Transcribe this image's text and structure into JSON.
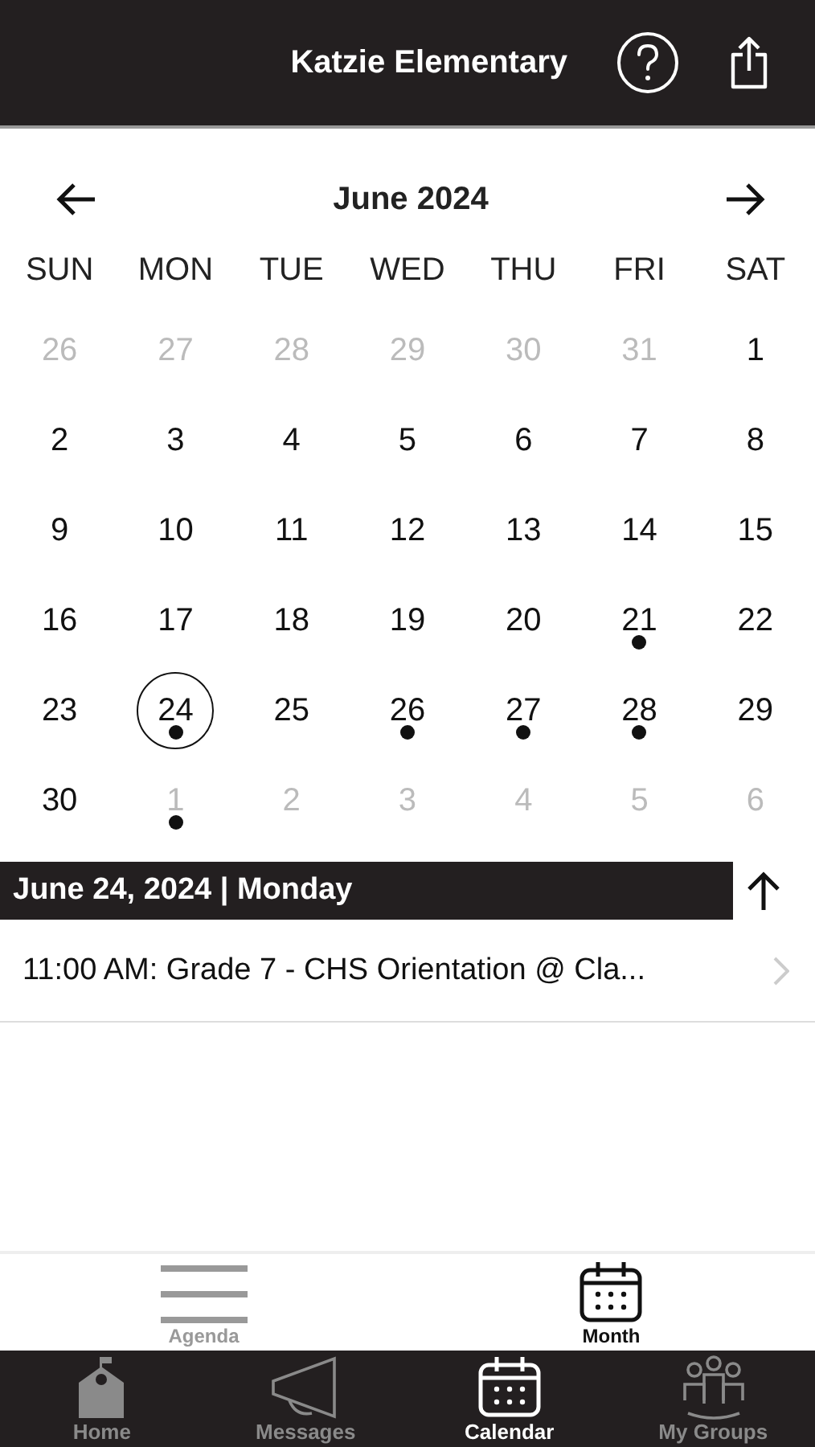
{
  "header": {
    "title": "Katzie Elementary"
  },
  "calendar": {
    "month": "June 2024",
    "weekdays": [
      "SUN",
      "MON",
      "TUE",
      "WED",
      "THU",
      "FRI",
      "SAT"
    ],
    "weeks": [
      [
        {
          "day": "26",
          "outside": true,
          "selected": false,
          "has_event": false
        },
        {
          "day": "27",
          "outside": true,
          "selected": false,
          "has_event": false
        },
        {
          "day": "28",
          "outside": true,
          "selected": false,
          "has_event": false
        },
        {
          "day": "29",
          "outside": true,
          "selected": false,
          "has_event": false
        },
        {
          "day": "30",
          "outside": true,
          "selected": false,
          "has_event": false
        },
        {
          "day": "31",
          "outside": true,
          "selected": false,
          "has_event": false
        },
        {
          "day": "1",
          "outside": false,
          "selected": false,
          "has_event": false
        }
      ],
      [
        {
          "day": "2",
          "outside": false,
          "selected": false,
          "has_event": false
        },
        {
          "day": "3",
          "outside": false,
          "selected": false,
          "has_event": false
        },
        {
          "day": "4",
          "outside": false,
          "selected": false,
          "has_event": false
        },
        {
          "day": "5",
          "outside": false,
          "selected": false,
          "has_event": false
        },
        {
          "day": "6",
          "outside": false,
          "selected": false,
          "has_event": false
        },
        {
          "day": "7",
          "outside": false,
          "selected": false,
          "has_event": false
        },
        {
          "day": "8",
          "outside": false,
          "selected": false,
          "has_event": false
        }
      ],
      [
        {
          "day": "9",
          "outside": false,
          "selected": false,
          "has_event": false
        },
        {
          "day": "10",
          "outside": false,
          "selected": false,
          "has_event": false
        },
        {
          "day": "11",
          "outside": false,
          "selected": false,
          "has_event": false
        },
        {
          "day": "12",
          "outside": false,
          "selected": false,
          "has_event": false
        },
        {
          "day": "13",
          "outside": false,
          "selected": false,
          "has_event": false
        },
        {
          "day": "14",
          "outside": false,
          "selected": false,
          "has_event": false
        },
        {
          "day": "15",
          "outside": false,
          "selected": false,
          "has_event": false
        }
      ],
      [
        {
          "day": "16",
          "outside": false,
          "selected": false,
          "has_event": false
        },
        {
          "day": "17",
          "outside": false,
          "selected": false,
          "has_event": false
        },
        {
          "day": "18",
          "outside": false,
          "selected": false,
          "has_event": false
        },
        {
          "day": "19",
          "outside": false,
          "selected": false,
          "has_event": false
        },
        {
          "day": "20",
          "outside": false,
          "selected": false,
          "has_event": false
        },
        {
          "day": "21",
          "outside": false,
          "selected": false,
          "has_event": true
        },
        {
          "day": "22",
          "outside": false,
          "selected": false,
          "has_event": false
        }
      ],
      [
        {
          "day": "23",
          "outside": false,
          "selected": false,
          "has_event": false
        },
        {
          "day": "24",
          "outside": false,
          "selected": true,
          "has_event": true
        },
        {
          "day": "25",
          "outside": false,
          "selected": false,
          "has_event": false
        },
        {
          "day": "26",
          "outside": false,
          "selected": false,
          "has_event": true
        },
        {
          "day": "27",
          "outside": false,
          "selected": false,
          "has_event": true
        },
        {
          "day": "28",
          "outside": false,
          "selected": false,
          "has_event": true
        },
        {
          "day": "29",
          "outside": false,
          "selected": false,
          "has_event": false
        }
      ],
      [
        {
          "day": "30",
          "outside": false,
          "selected": false,
          "has_event": false
        },
        {
          "day": "1",
          "outside": true,
          "selected": false,
          "has_event": true
        },
        {
          "day": "2",
          "outside": true,
          "selected": false,
          "has_event": false
        },
        {
          "day": "3",
          "outside": true,
          "selected": false,
          "has_event": false
        },
        {
          "day": "4",
          "outside": true,
          "selected": false,
          "has_event": false
        },
        {
          "day": "5",
          "outside": true,
          "selected": false,
          "has_event": false
        },
        {
          "day": "6",
          "outside": true,
          "selected": false,
          "has_event": false
        }
      ]
    ]
  },
  "selected_date": "June 24, 2024 | Monday",
  "events": [
    {
      "text": "11:00 AM: Grade 7 - CHS Orientation @ Cla..."
    }
  ],
  "view_switch": [
    {
      "label": "Agenda",
      "kind": "agenda",
      "selected": false
    },
    {
      "label": "Month",
      "kind": "month",
      "selected": true
    }
  ],
  "tab_bar": [
    {
      "label": "Home",
      "kind": "home",
      "selected": false
    },
    {
      "label": "Messages",
      "kind": "messages",
      "selected": false
    },
    {
      "label": "Calendar",
      "kind": "calendar",
      "selected": true
    },
    {
      "label": "My Groups",
      "kind": "groups",
      "selected": false
    }
  ]
}
